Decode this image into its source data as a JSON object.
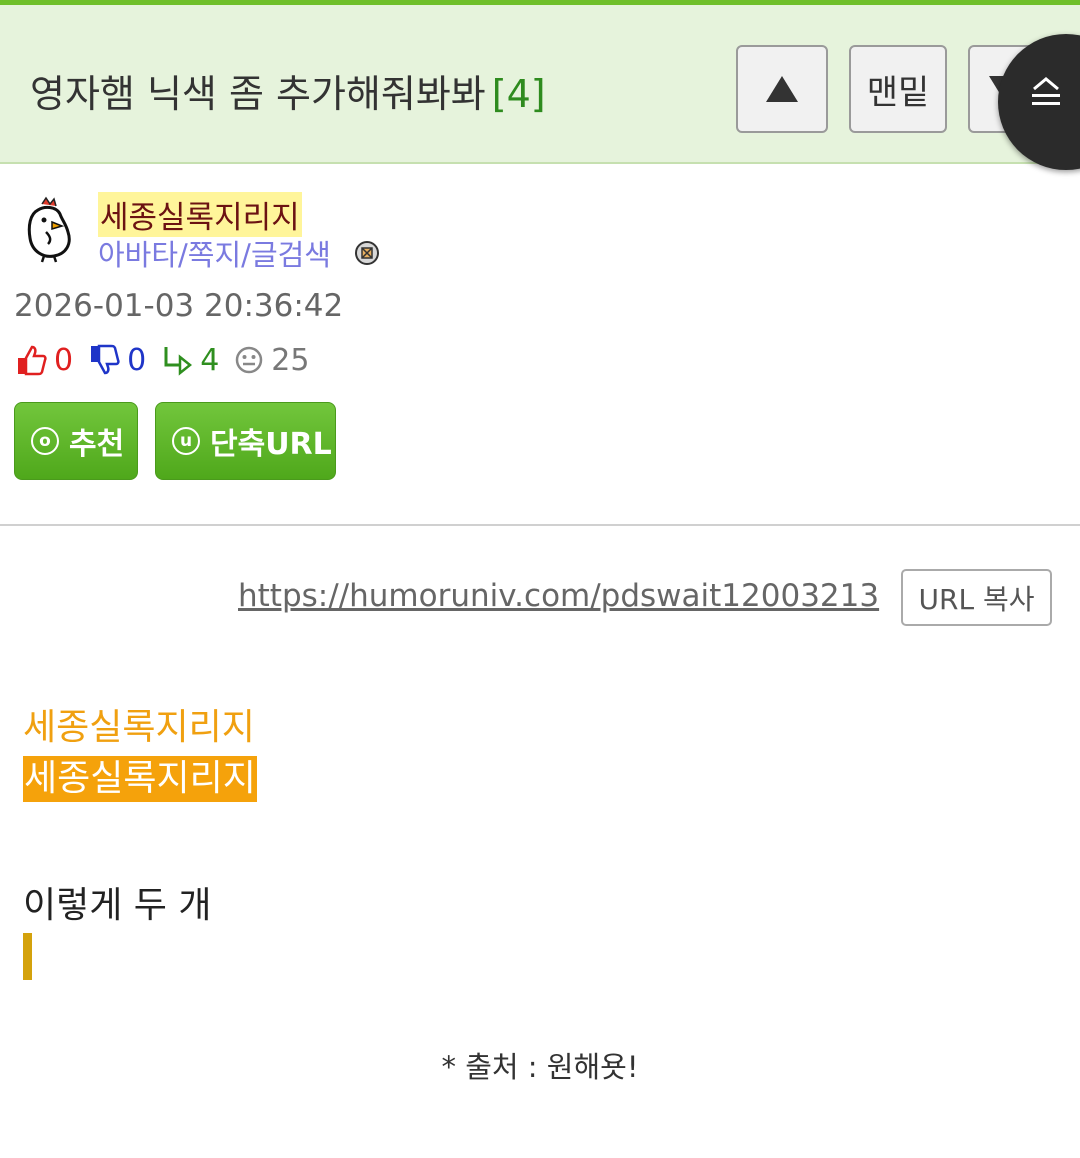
{
  "header": {
    "title": "영자햄 닉색 좀 추가해줘봐봐",
    "comment_count": "[4]",
    "bottom_button_label": "맨밑"
  },
  "author": {
    "nickname": "세종실록지리지",
    "links": "아바타/쪽지/글검색",
    "date": "2026-01-03 20:36:42"
  },
  "stats": {
    "upvotes": "0",
    "downvotes": "0",
    "replies": "4",
    "views": "25"
  },
  "actions": {
    "recommend_icon": "o",
    "recommend_label": "추천",
    "shorturl_icon": "u",
    "shorturl_label": "단축URL"
  },
  "post": {
    "url": "https://humoruniv.com/pdswait12003213",
    "copy_label": "URL 복사",
    "line1": "세종실록지리지",
    "line2": "세종실록지리지",
    "line3": "이렇게 두 개",
    "source": "* 출처 : 원해욧!"
  },
  "colors": {
    "header_bg": "#e6f3dc",
    "header_border": "#6fbf2a",
    "count_green": "#2e8b1e",
    "nick_highlight": "#fff59a",
    "nick_text": "#6b1212",
    "link_purple": "#7a7ae0",
    "up_red": "#e02020",
    "down_blue": "#1f35c8",
    "reply_green": "#2f8f1f",
    "button_green": "#5fb22a",
    "orange_text": "#f0a010",
    "orange_bg": "#f5a20b"
  },
  "icons": [
    "up-arrow-icon",
    "down-arrow-icon",
    "scroll-menu-icon",
    "chicken-avatar-icon",
    "badge-icon",
    "thumbs-up-icon",
    "thumbs-down-icon",
    "reply-arrow-icon",
    "smiley-view-icon"
  ]
}
